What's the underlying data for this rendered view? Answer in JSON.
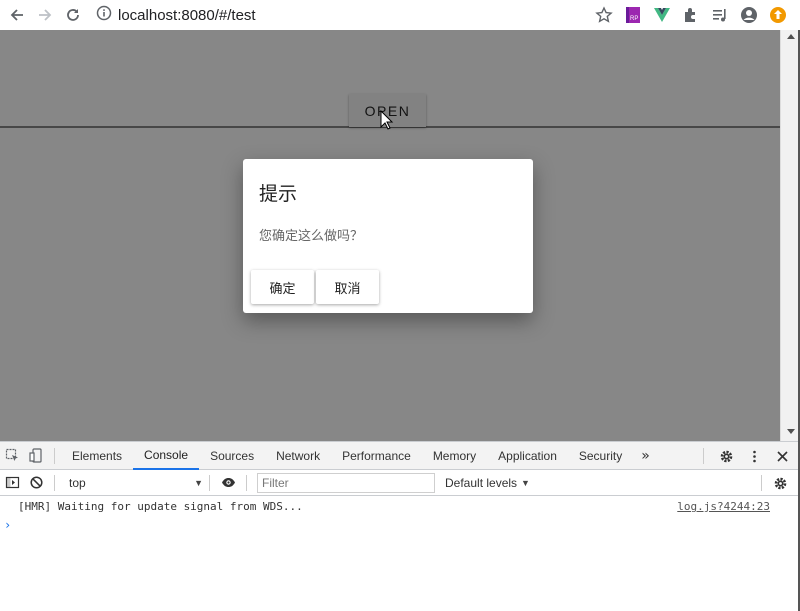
{
  "browser": {
    "url": "localhost:8080/#/test",
    "icons": [
      "back-icon",
      "forward-icon",
      "reload-icon",
      "info-icon",
      "star-icon",
      "rp-extension-icon",
      "vue-devtools-icon",
      "extensions-icon",
      "media-icon",
      "profile-icon",
      "update-icon"
    ],
    "rp_badge": "RP"
  },
  "page": {
    "open_button": "OPEN",
    "dialog": {
      "title": "提示",
      "message": "您确定这么做吗？",
      "confirm": "确定",
      "cancel": "取消"
    }
  },
  "devtools": {
    "tabs": [
      "Elements",
      "Console",
      "Sources",
      "Network",
      "Performance",
      "Memory",
      "Application",
      "Security"
    ],
    "active_tab": "Console",
    "more": "»",
    "context": "top",
    "filter_placeholder": "Filter",
    "levels": "Default levels",
    "log_message": "[HMR] Waiting for update signal from WDS...",
    "log_source": "log.js?4244:23",
    "prompt": "›"
  },
  "colors": {
    "accent": "#1a73e8",
    "overlay": "#858585",
    "rp_purple": "#9c27b0",
    "vue_green": "#41b883",
    "update_orange": "#f29900"
  }
}
